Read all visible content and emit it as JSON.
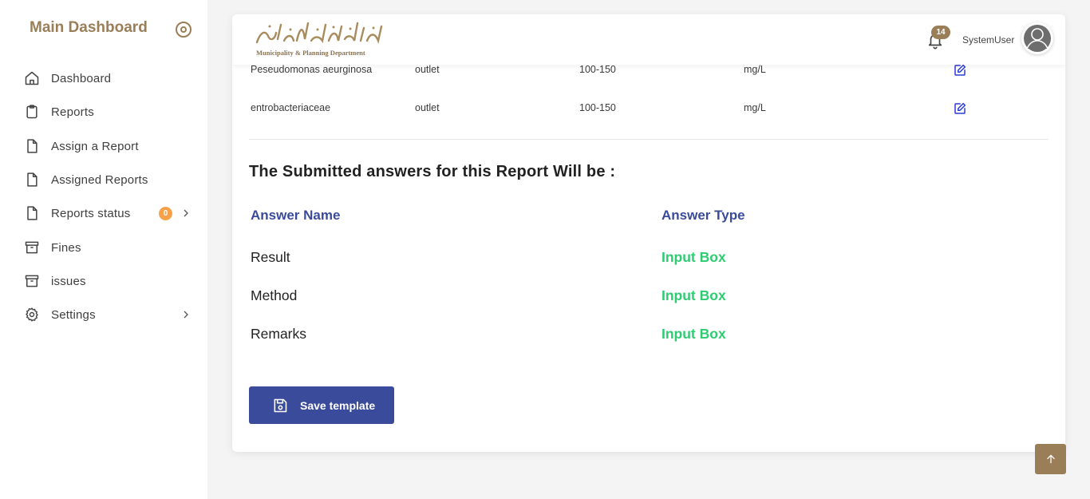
{
  "sidebar": {
    "brand": "Main Dashboard",
    "items": [
      {
        "label": "Dashboard",
        "icon": "home-icon"
      },
      {
        "label": "Reports",
        "icon": "clipboard-icon"
      },
      {
        "label": "Assign a Report",
        "icon": "file-icon"
      },
      {
        "label": "Assigned Reports",
        "icon": "file-icon"
      },
      {
        "label": "Reports status",
        "icon": "file-icon",
        "badge": "0"
      },
      {
        "label": "Fines",
        "icon": "archive-icon"
      },
      {
        "label": "issues",
        "icon": "archive-icon"
      },
      {
        "label": "Settings",
        "icon": "gear-icon"
      }
    ]
  },
  "header": {
    "logo_subtitle": "Municipality & Planning Department",
    "notification_count": "14",
    "username": "SystemUser"
  },
  "table": {
    "rows": [
      {
        "name": "Peseudomonas aeurginosa",
        "location": "outlet",
        "range": "100-150",
        "unit": "mg/L"
      },
      {
        "name": "entrobacteriaceae",
        "location": "outlet",
        "range": "100-150",
        "unit": "mg/L"
      }
    ]
  },
  "answers": {
    "title": "The Submitted answers for this Report Will be :",
    "col_name": "Answer Name",
    "col_type": "Answer Type",
    "items": [
      {
        "name": "Result",
        "type": "Input Box"
      },
      {
        "name": "Method",
        "type": "Input Box"
      },
      {
        "name": "Remarks",
        "type": "Input Box"
      }
    ]
  },
  "actions": {
    "save_label": "Save template"
  },
  "colors": {
    "brand": "#9a7e57",
    "primary": "#3b4b9b",
    "success": "#2ecc71",
    "badge": "#f7a24b"
  }
}
